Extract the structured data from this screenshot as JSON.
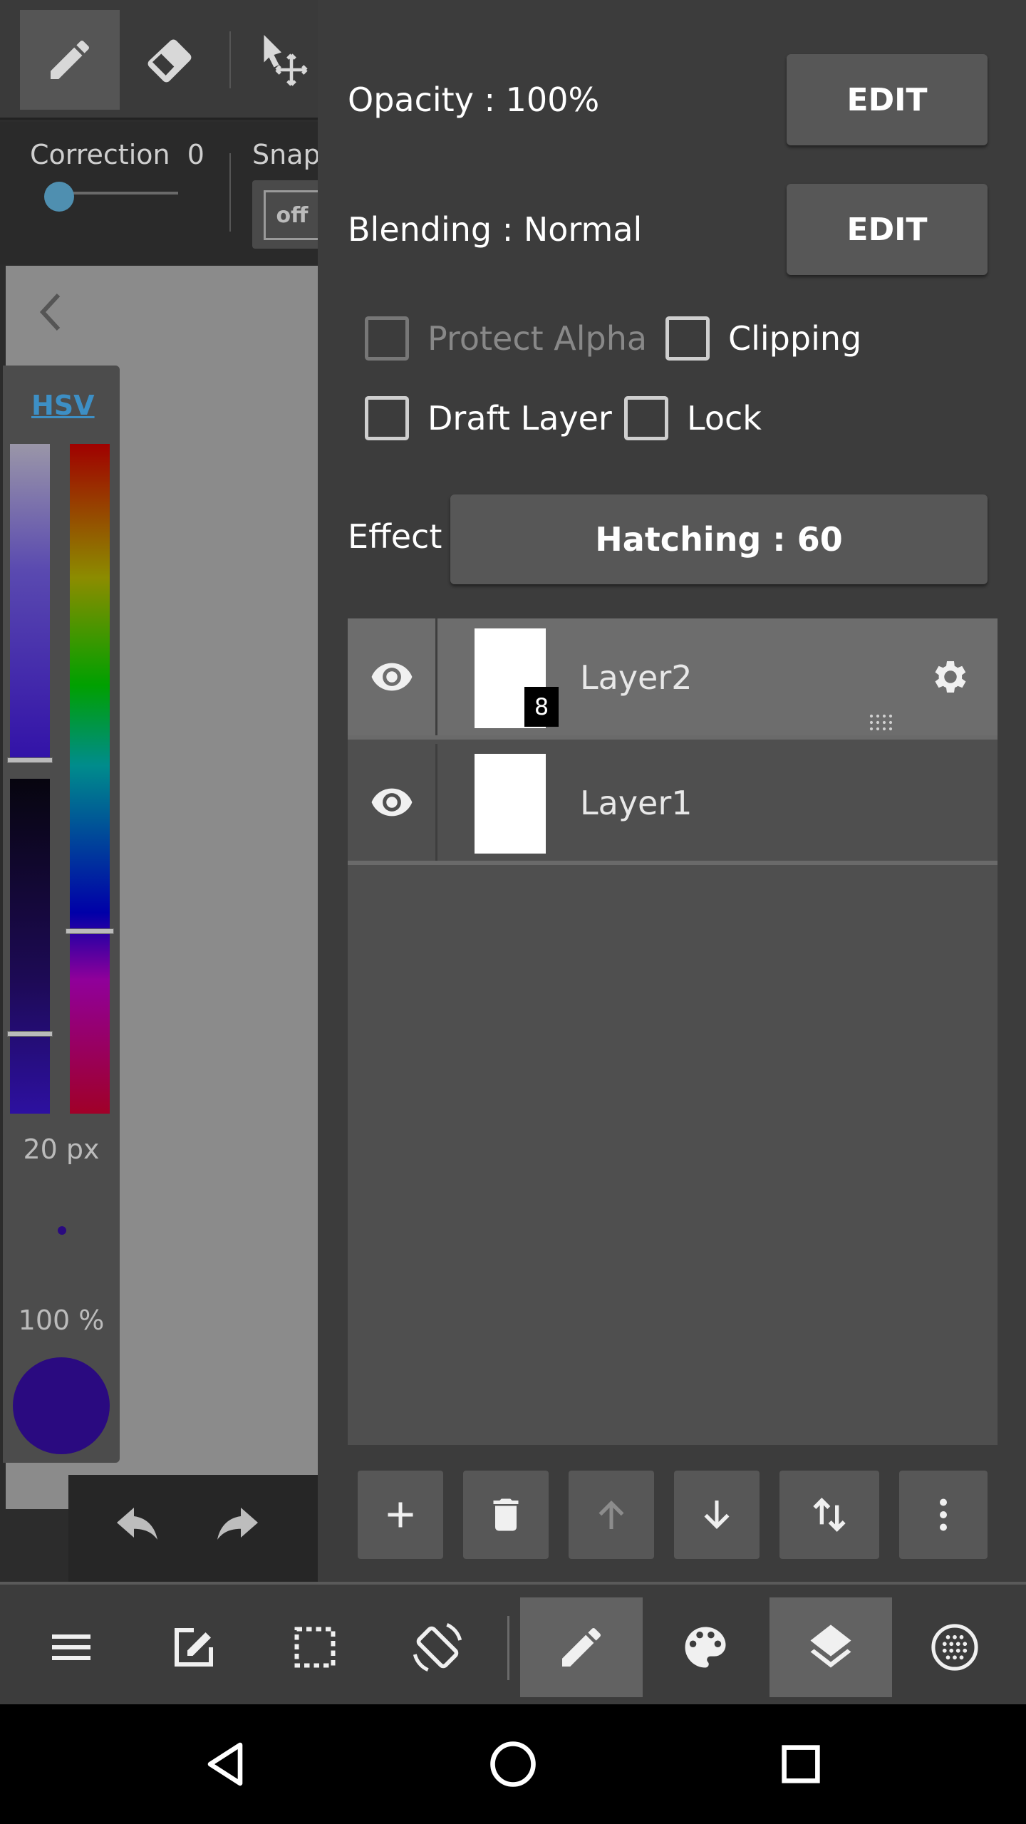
{
  "left_toolbar": {
    "correction_label": "Correction",
    "correction_value": "0",
    "snap_label": "Snap",
    "snap_toggle_label": "off"
  },
  "color_panel": {
    "mode_link": "HSV",
    "brush_size": "20 px",
    "brush_opacity": "100 %",
    "current_color": "#2a0a80"
  },
  "layer_settings": {
    "opacity_label": "Opacity : 100%",
    "opacity_edit": "EDIT",
    "blending_label": "Blending : Normal",
    "blending_edit": "EDIT",
    "checkboxes": {
      "protect_alpha": "Protect Alpha",
      "clipping": "Clipping",
      "draft_layer": "Draft Layer",
      "lock": "Lock"
    },
    "effect_label": "Effect",
    "effect_value": "Hatching : 60"
  },
  "layers": [
    {
      "name": "Layer2",
      "badge": "8",
      "selected": true
    },
    {
      "name": "Layer1",
      "selected": false
    }
  ],
  "layer_actions": [
    "add-layer",
    "delete-layer",
    "move-up",
    "move-down",
    "swap",
    "more"
  ],
  "bottom_nav": [
    "menu",
    "edit",
    "selection",
    "rotate",
    "brush",
    "palette",
    "layers",
    "material"
  ],
  "colors": {
    "panel_bg": "#3c3c3c",
    "button_bg": "#575757",
    "selected_layer": "#6d6d6d",
    "accent_link": "#3d8fc5"
  }
}
